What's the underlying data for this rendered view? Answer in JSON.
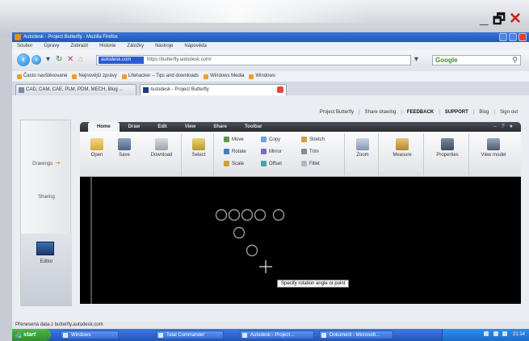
{
  "viewer": {
    "minimize": "_",
    "restore": "🗗",
    "close": "✕"
  },
  "browser": {
    "window_title": "Autodesk - Project Butterfly - Mozilla Firefox",
    "menu": [
      "Soubor",
      "Úpravy",
      "Zobrazit",
      "Historie",
      "Záložky",
      "Nástroje",
      "Nápověda"
    ],
    "url_identity": "autodesk.com",
    "url": "https://butterfly.autodesk.com/",
    "search_placeholder": "Google",
    "bookmarks": [
      "Často navštěvované",
      "Nejnovější zprávy",
      "Lifehacker – Tips and downloads",
      "Windows Media",
      "Windows"
    ],
    "tabs": [
      {
        "label": "CAD, CAM, CAE, PLM, PDM, MECH, Blog ..."
      },
      {
        "label": "Autodesk - Project Butterfly"
      }
    ],
    "status_text": "Přenesená data z butterfly.autodesk.com"
  },
  "site": {
    "toplinks": [
      "Project Butterfly",
      "Share drawing",
      "FEEDBACK",
      "SUPPORT",
      "Blog",
      "Sign out"
    ],
    "left_panel": {
      "item_1": "Drawings",
      "item_2": "Sharing",
      "editor": "Editor"
    }
  },
  "app": {
    "ribbon_tabs": [
      "Home",
      "Draw",
      "Edit",
      "View",
      "Share",
      "Toolbar"
    ],
    "ribbon": {
      "open": "Open",
      "save": "Save",
      "download": "Download",
      "select": "Select",
      "move": "Move",
      "copy": "Copy",
      "stretch": "Stretch",
      "rotate": "Rotate",
      "mirror": "Mirror",
      "trim": "Trim",
      "scale": "Scale",
      "offset": "Offset",
      "fillet": "Fillet",
      "zoom": "Zoom",
      "measure": "Measure",
      "properties": "Properties",
      "view_model": "View model"
    },
    "tooltip": "Specify rotation angle or point",
    "circles_label": ""
  },
  "taskbar": {
    "start": "start",
    "tasks": [
      "Windows",
      "Total Commander",
      "Autodesk - Project...",
      "Dokument - Microsoft..."
    ],
    "clock": "21:14"
  }
}
